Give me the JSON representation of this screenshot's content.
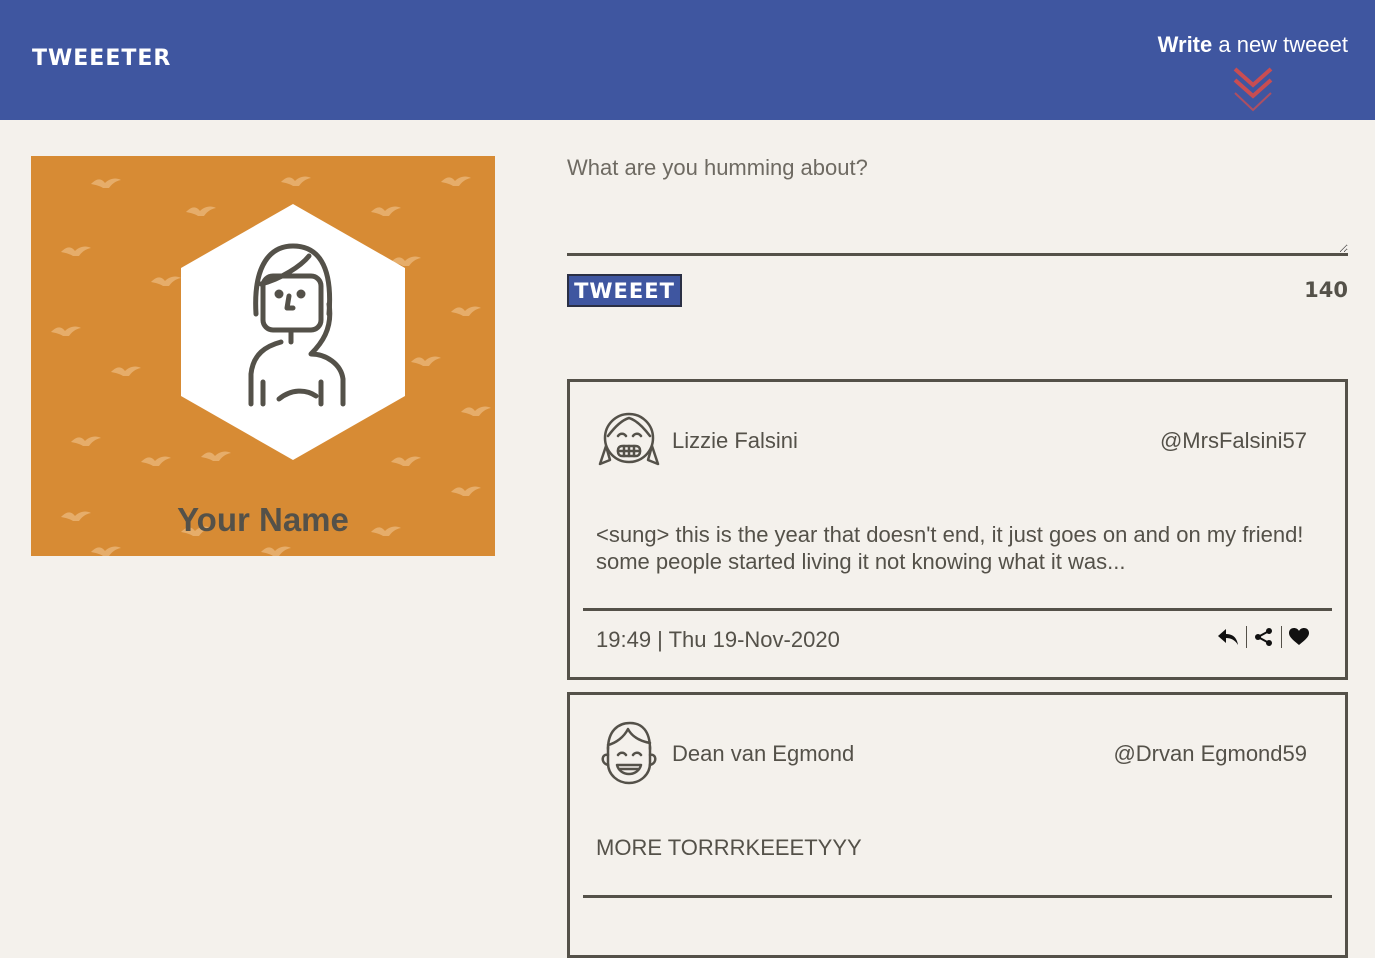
{
  "nav": {
    "brand": "TWEEETER",
    "compose_bold": "Write",
    "compose_rest": " a new tweeet",
    "compose_icon": "double-chevron-down-icon"
  },
  "profile": {
    "name": "Your Name",
    "avatar_icon": "woman-avatar-icon",
    "background_color": "#d78b34"
  },
  "composer": {
    "placeholder": "What are you humming about?",
    "value": "",
    "button_label": "TWEEET",
    "counter": "140"
  },
  "tweets": [
    {
      "name": "Lizzie Falsini",
      "handle": "@MrsFalsini57",
      "text": "<sung> this is the year that doesn't end, it just goes on and on my friend! some people started living it not knowing what it was...",
      "time": "19:49 | Thu 19-Nov-2020",
      "avatar_icon": "girl-avatar-icon"
    },
    {
      "name": "Dean van Egmond",
      "handle": "@Drvan Egmond59",
      "text": "MORE TORRRKEEETYYY",
      "time": "",
      "avatar_icon": "boy-avatar-icon"
    }
  ],
  "colors": {
    "nav": "#3f56a0",
    "background": "#f4f1ec",
    "text": "#545149",
    "accent_red": "#c94d52"
  }
}
